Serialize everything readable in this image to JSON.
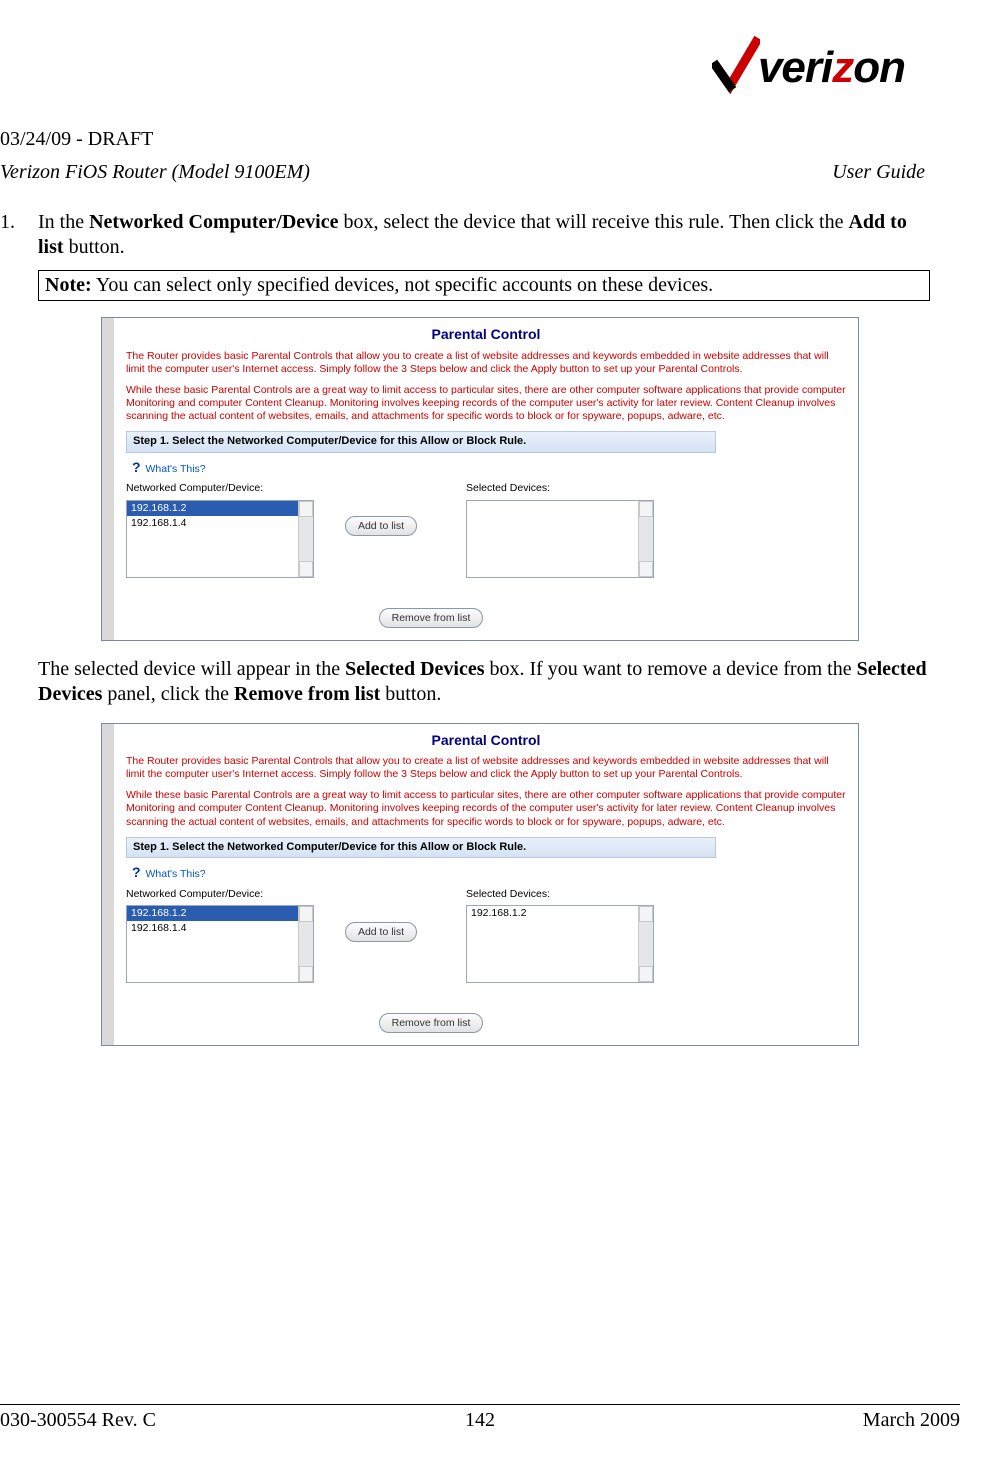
{
  "header": {
    "brand_prefix": "veri",
    "brand_accent": "z",
    "brand_suffix": "on",
    "draft_line": "03/24/09 - DRAFT",
    "model_line": "Verizon FiOS Router (Model 9100EM)",
    "guide_label": "User Guide"
  },
  "step1": {
    "num": "1.",
    "pre": "In the ",
    "b1": "Networked Computer/Device",
    "mid": " box, select the device that will receive this rule. Then click the ",
    "b2": "Add to list",
    "post": " button."
  },
  "note": {
    "label": "Note:",
    "text": " You can select only specified devices, not specific accounts on these devices."
  },
  "panel": {
    "title": "Parental Control",
    "desc1": "The Router provides basic Parental Controls that allow you to create a list of website addresses and keywords embedded in website addresses that will limit the computer user's Internet access. Simply follow the 3 Steps below and click the Apply button to set up your Parental Controls.",
    "desc2": "While these basic Parental Controls are a great way to limit access to particular sites, there are other computer software applications that provide computer Monitoring and computer Content Cleanup. Monitoring involves keeping records of the computer user's activity for later review. Content Cleanup involves scanning the actual content of websites, emails, and attachments for specific words to block or for spyware, popups, adware, etc.",
    "step_label": "Step 1. Select the Networked Computer/Device for this Allow or Block Rule.",
    "whats_this": "What's This?",
    "left_label": "Networked Computer/Device:",
    "right_label": "Selected Devices:",
    "add_btn": "Add to list",
    "remove_btn": "Remove from list",
    "devices": [
      "192.168.1.2",
      "192.168.1.4"
    ]
  },
  "mid_para": {
    "pre": "The selected device will appear in the ",
    "b1": "Selected Devices",
    "mid1": " box. If you want to remove a device from the ",
    "b2": "Selected Devices",
    "mid2": " panel, click the ",
    "b3": "Remove from list",
    "post": " button."
  },
  "shot2_selected": "192.168.1.2",
  "footer": {
    "doc_id": "030-300554 Rev. C",
    "page_num": "142",
    "date": "March 2009"
  }
}
